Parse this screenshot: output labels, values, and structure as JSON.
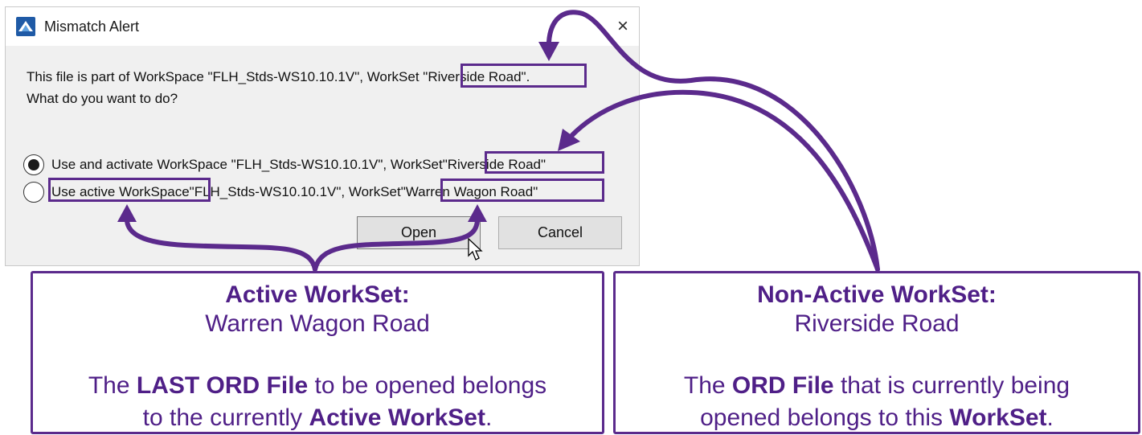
{
  "dialog": {
    "title": "Mismatch Alert",
    "close_glyph": "×",
    "message_line1": "This file is part of WorkSpace \"FLH_Stds-WS10.10.1V\", WorkSet ",
    "message_workset": "\"Riverside Road\".",
    "message_line2": "What do you want to do?",
    "options": [
      {
        "prefix": "Use and activate WorkSpace \"FLH_Stds-WS10.10.1V\", WorkSet ",
        "workset": "\"Riverside Road\"",
        "selected": true
      },
      {
        "lead": "Use active WorkSpace",
        "middle": " \"FLH_Stds-WS10.10.1V\", WorkSet ",
        "workset": "\"Warren Wagon Road\"",
        "selected": false
      }
    ],
    "buttons": {
      "open": "Open",
      "cancel": "Cancel"
    }
  },
  "callouts": {
    "left": {
      "heading": "Active WorkSet:",
      "name": "Warren Wagon Road",
      "desc_pre": "The ",
      "desc_bold1": "LAST ORD File",
      "desc_mid": " to be opened belongs",
      "desc_line2_pre": "to the currently ",
      "desc_bold2": "Active WorkSet",
      "desc_end": "."
    },
    "right": {
      "heading": "Non-Active WorkSet:",
      "name": "Riverside Road",
      "desc_pre": "The ",
      "desc_bold1": "ORD File",
      "desc_mid": " that is currently being",
      "desc_line2_pre": "opened belongs to this ",
      "desc_bold2": "WorkSet",
      "desc_end": "."
    }
  },
  "colors": {
    "annotation_purple": "#5b2a8c",
    "callout_text": "#4f1f87",
    "dialog_bg": "#f0f0f0"
  },
  "icons": {
    "app": "app-logo-icon",
    "close": "close-icon",
    "cursor": "mouse-pointer-icon"
  }
}
